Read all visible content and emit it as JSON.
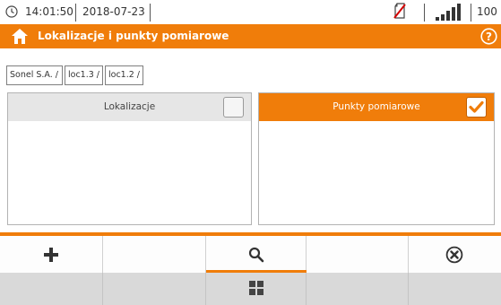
{
  "status": {
    "time": "14:01:50",
    "date": "2018-07-23",
    "battery_percent": "100 %",
    "signal_bars": 4,
    "icons": [
      "clock-icon",
      "sd-card-missing-icon",
      "signal-icon",
      "battery-icon",
      "power-plug-icon"
    ]
  },
  "header": {
    "title": "Lokalizacje i punkty pomiarowe",
    "icons": [
      "home-icon",
      "help-icon"
    ]
  },
  "breadcrumb": [
    "Sonel S.A. /",
    "loc1.3 /",
    "loc1.2 /"
  ],
  "panels": {
    "left": {
      "title": "Lokalizacje",
      "checked": false
    },
    "right": {
      "title": "Punkty pomiarowe",
      "checked": true
    }
  },
  "toolbar": {
    "buttons": [
      "add-icon",
      "",
      "search-icon",
      "",
      "cancel-icon"
    ],
    "active": "search-icon",
    "second_row": [
      "",
      "",
      "grid-menu-icon",
      "",
      ""
    ]
  },
  "colors": {
    "accent": "#f07d0a",
    "panel_inactive": "#e6e6e6",
    "toolbar_lower": "#d9d9d9"
  }
}
